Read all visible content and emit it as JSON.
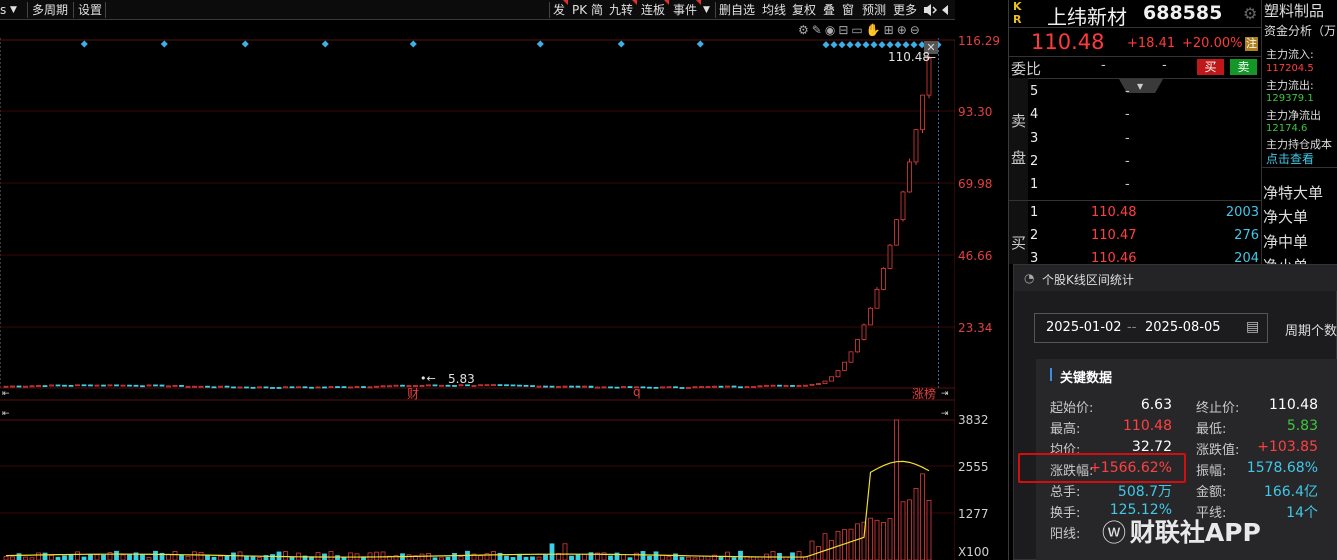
{
  "toolbar": {
    "left_items": [
      "s",
      "多周期",
      "设置"
    ],
    "right_items": [
      "发",
      "PK",
      "简",
      "九转",
      "连板",
      "事件",
      "▼",
      "删自选",
      "均线",
      "复权",
      "叠",
      "窗",
      "预测",
      "更多"
    ]
  },
  "chart": {
    "price_axis": [
      "116.29",
      "93.30",
      "69.98",
      "46.66",
      "23.34"
    ],
    "last_price_tag": "110.48",
    "low_marker": "5.83",
    "event_labels": [
      "财",
      "q"
    ],
    "badge_label": "涨榜",
    "volume_axis": [
      "3832",
      "2555",
      "1277"
    ],
    "volume_unit": "X100"
  },
  "quote": {
    "kr": [
      "K",
      "R"
    ],
    "name": "上纬新材",
    "code": "688585",
    "price": "110.48",
    "change": "+18.41",
    "change_pct": "+20.00%",
    "badge": "注",
    "weibi_label": "委比",
    "weibi_val1": "-",
    "weibi_val2": "-",
    "buy_btn": "买",
    "sell_btn": "卖",
    "sell_side_label": [
      "卖",
      "盘"
    ],
    "buy_side_label": "买",
    "sell_levels": [
      {
        "level": "5",
        "price": "-",
        "vol": ""
      },
      {
        "level": "4",
        "price": "-",
        "vol": ""
      },
      {
        "level": "3",
        "price": "-",
        "vol": ""
      },
      {
        "level": "2",
        "price": "-",
        "vol": ""
      },
      {
        "level": "1",
        "price": "-",
        "vol": ""
      }
    ],
    "buy_levels": [
      {
        "level": "1",
        "price": "110.48",
        "vol": "2003"
      },
      {
        "level": "2",
        "price": "110.47",
        "vol": "276"
      },
      {
        "level": "3",
        "price": "110.46",
        "vol": "204"
      }
    ]
  },
  "side_info": {
    "title": "塑料制品",
    "subtitle": "资金分析（万",
    "inflow_label": "主力流入:",
    "inflow_val": "117204.5",
    "outflow_label": "主力流出:",
    "outflow_val": "129379.1",
    "net_label": "主力净流出",
    "net_val": "12174.6",
    "cost_label": "主力持仓成本",
    "link": "点击查看",
    "orders": [
      "净特大单",
      "净大单",
      "净中单",
      "净小单"
    ]
  },
  "popup": {
    "title": "个股K线区间统计",
    "date_start": "2025-01-02",
    "date_sep": "--",
    "date_end": "2025-08-05",
    "period_label": "周期个数",
    "section_title": "关键数据",
    "rows": [
      {
        "l1": "起始价:",
        "v1": "6.63",
        "c1": "#ffffff",
        "l2": "终止价:",
        "v2": "110.48",
        "c2": "#ffffff"
      },
      {
        "l1": "最高:",
        "v1": "110.48",
        "c1": "#ff4040",
        "l2": "最低:",
        "v2": "5.83",
        "c2": "#3cc83c"
      },
      {
        "l1": "均价:",
        "v1": "32.72",
        "c1": "#ffffff",
        "l2": "涨跌值:",
        "v2": "+103.85",
        "c2": "#ff4040"
      },
      {
        "l1": "涨跌幅:",
        "v1": "+1566.62%",
        "c1": "#ff4040",
        "l2": "振幅:",
        "v2": "1578.68%",
        "c2": "#41c7e8"
      },
      {
        "l1": "总手:",
        "v1": "508.7万",
        "c1": "#41c7e8",
        "l2": "金额:",
        "v2": "166.4亿",
        "c2": "#41c7e8"
      },
      {
        "l1": "换手:",
        "v1": "125.12%",
        "c1": "#41c7e8",
        "l2": "平线:",
        "v2": "14个",
        "c2": "#41c7e8"
      },
      {
        "l1": "阳线:",
        "v1": "",
        "c1": "#ff4040",
        "l2": "",
        "v2": "",
        "c2": "#ffffff"
      }
    ]
  },
  "watermark": "财联社APP",
  "colors": {
    "up": "#e03c3c",
    "down": "#3cd2e6",
    "accent_red": "#d01010"
  }
}
